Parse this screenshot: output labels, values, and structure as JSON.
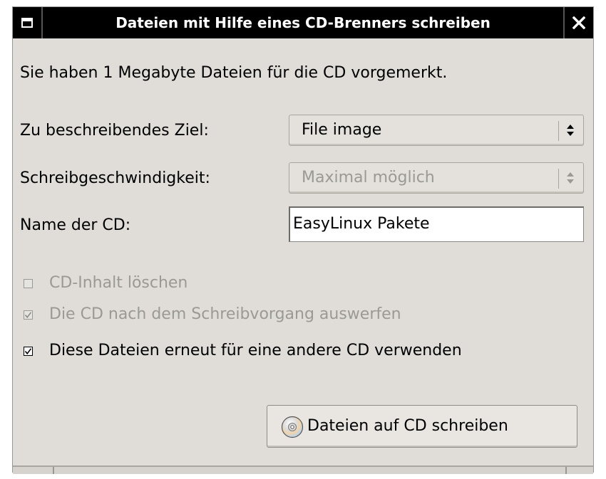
{
  "window": {
    "title": "Dateien mit Hilfe eines CD-Brenners schreiben"
  },
  "info_text": "Sie haben 1 Megabyte Dateien für die CD vorgemerkt.",
  "target": {
    "label": "Zu beschreibendes Ziel:",
    "value": "File image"
  },
  "speed": {
    "label": "Schreibgeschwindigkeit:",
    "value": "Maximal möglich",
    "disabled": true
  },
  "cd_name": {
    "label": "Name der CD:",
    "value": "EasyLinux Pakete"
  },
  "options": [
    {
      "label": "CD-Inhalt löschen",
      "checked": false,
      "disabled": true
    },
    {
      "label": "Die CD nach dem Schreibvorgang auswerfen",
      "checked": true,
      "disabled": true
    },
    {
      "label": "Diese Dateien erneut für eine andere CD verwenden",
      "checked": true,
      "disabled": false
    }
  ],
  "actions": {
    "write_label": "Dateien auf CD schreiben"
  },
  "icons": {
    "window_menu": "window-menu-icon",
    "close": "close-icon",
    "combo_arrows": "combo-arrows-icon",
    "cd": "cd-disc-icon",
    "checkmark": "checkmark-icon"
  },
  "colors": {
    "titlebar": "#000000",
    "dialog_bg": "#e0ddd8",
    "disabled_text": "#9b9994"
  }
}
